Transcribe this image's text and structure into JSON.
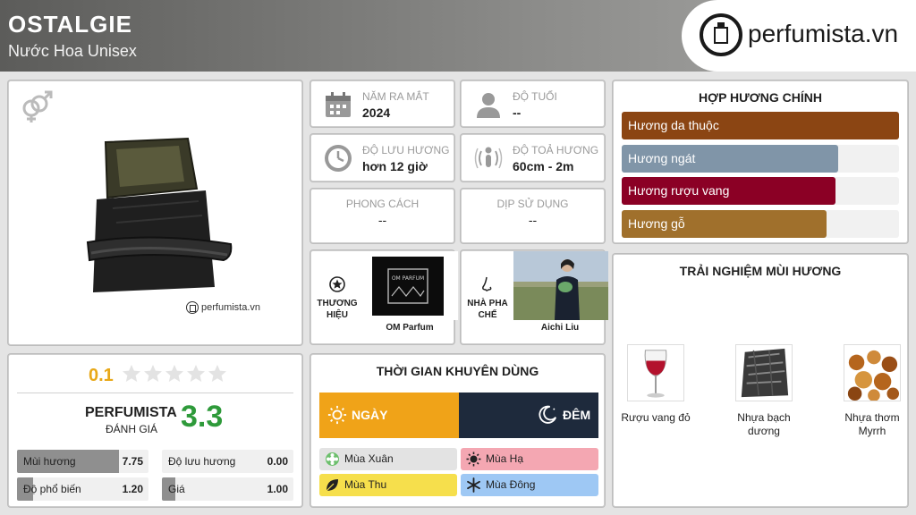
{
  "header": {
    "title": "OSTALGIE",
    "subtitle": "Nước Hoa Unisex",
    "logo_text": "perfumista.vn"
  },
  "product": {
    "watermark": "perfumista.vn"
  },
  "info": {
    "launch_year": {
      "label": "NĂM RA MẮT",
      "value": "2024"
    },
    "age": {
      "label": "ĐỘ TUỔI",
      "value": "--"
    },
    "longevity": {
      "label": "ĐỘ LƯU HƯƠNG",
      "value": "hơn 12 giờ"
    },
    "sillage": {
      "label": "ĐỘ TOẢ HƯƠNG",
      "value": "60cm - 2m"
    },
    "style": {
      "label": "PHONG CÁCH",
      "value": "--"
    },
    "occasion": {
      "label": "DỊP SỬ DỤNG",
      "value": "--"
    }
  },
  "brand": {
    "label": "THƯƠNG HIỆU",
    "name": "OM Parfum"
  },
  "perfumer": {
    "label": "NHÀ PHA CHẾ",
    "name": "Aichi Liu"
  },
  "accords": {
    "title": "HỢP HƯƠNG CHÍNH",
    "items": [
      {
        "label": "Hương da thuộc",
        "level": 1.0,
        "color": "#8b4513"
      },
      {
        "label": "Hương ngát",
        "level": 0.78,
        "color": "#8095a8"
      },
      {
        "label": "Hương rượu vang",
        "level": 0.77,
        "color": "#8b0025"
      },
      {
        "label": "Hương gỗ",
        "level": 0.74,
        "color": "#a0702c"
      }
    ]
  },
  "experience": {
    "title": "TRẢI NGHIỆM MÙI HƯƠNG",
    "items": [
      {
        "label": "Rượu vang đỏ"
      },
      {
        "label": "Nhựa bạch dương"
      },
      {
        "label": "Nhựa thơm Myrrh"
      }
    ]
  },
  "rating": {
    "score": "0.1",
    "stars": 0,
    "perfumista_label": "PERFUMISTA",
    "perfumista_sub": "ĐÁNH GIÁ",
    "perfumista_score": "3.3",
    "metrics": [
      {
        "label": "Mùi hương",
        "value": "7.75",
        "level": 0.775
      },
      {
        "label": "Độ lưu hương",
        "value": "0.00",
        "level": 0.0
      },
      {
        "label": "Độ phổ biến",
        "value": "1.20",
        "level": 0.12
      },
      {
        "label": "Giá",
        "value": "1.00",
        "level": 0.1
      }
    ]
  },
  "time": {
    "title": "THỜI GIAN KHUYÊN DÙNG",
    "day": "NGÀY",
    "night": "ĐÊM",
    "seasons": [
      {
        "label": "Mùa Xuân",
        "color": "#e3e3e3"
      },
      {
        "label": "Mùa Hạ",
        "color": "#f4a7b2"
      },
      {
        "label": "Mùa Thu",
        "color": "#f6df4c"
      },
      {
        "label": "Mùa Đông",
        "color": "#9ec8f4"
      }
    ]
  }
}
